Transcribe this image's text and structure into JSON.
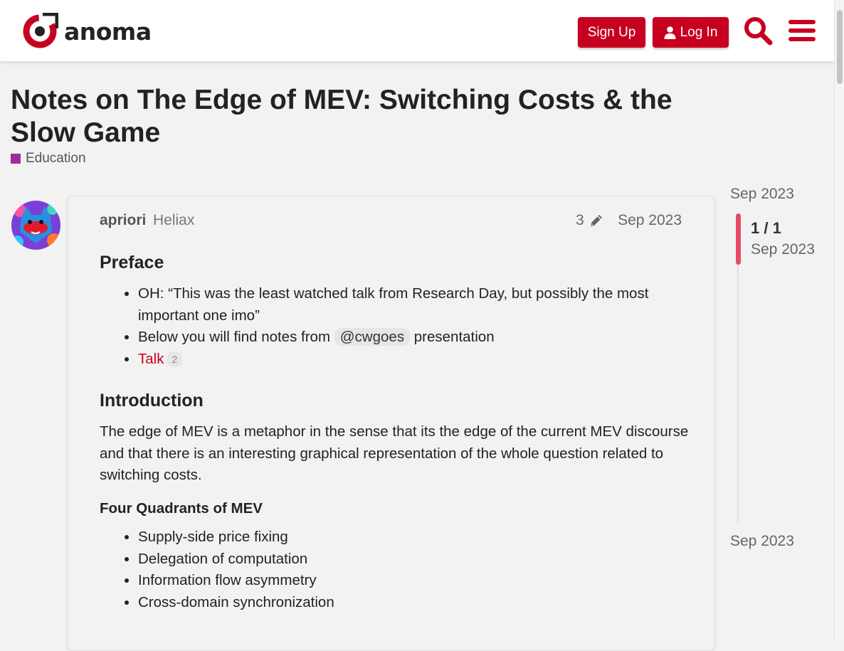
{
  "header": {
    "brand": "anoma",
    "signup_label": "Sign Up",
    "login_label": "Log In",
    "icons": [
      "anoma-logo-icon",
      "user-icon",
      "search-icon",
      "hamburger-menu-icon"
    ],
    "accent_color": "#c8001f"
  },
  "topic": {
    "title": "Notes on The Edge of MEV: Switching Costs & the Slow Game",
    "category": "Education",
    "category_color": "#9a2e9c"
  },
  "post": {
    "username": "apriori",
    "user_title": "Heliax",
    "edit_count": "3",
    "date": "Sep 2023",
    "preface_heading": "Preface",
    "preface_items": [
      "OH: “This was the least watched talk from Research Day, but possibly the most important one imo”",
      "Below you will find notes from",
      "presentation"
    ],
    "mention": "@cwgoes",
    "talk_link": "Talk",
    "talk_clicks": "2",
    "intro_heading": "Introduction",
    "intro_paragraph": "The edge of MEV is a metaphor in the sense that its the edge of the current MEV discourse and that there is an interesting graphical representation of the whole question related to switching costs.",
    "quadrants_heading": "Four Quadrants of MEV",
    "quadrants": [
      "Supply-side price fixing",
      "Delegation of computation",
      "Information flow asymmetry",
      "Cross-domain synchronization"
    ]
  },
  "timeline": {
    "start_date": "Sep 2023",
    "position": "1 / 1",
    "position_date": "Sep 2023",
    "end_date": "Sep 2023"
  }
}
